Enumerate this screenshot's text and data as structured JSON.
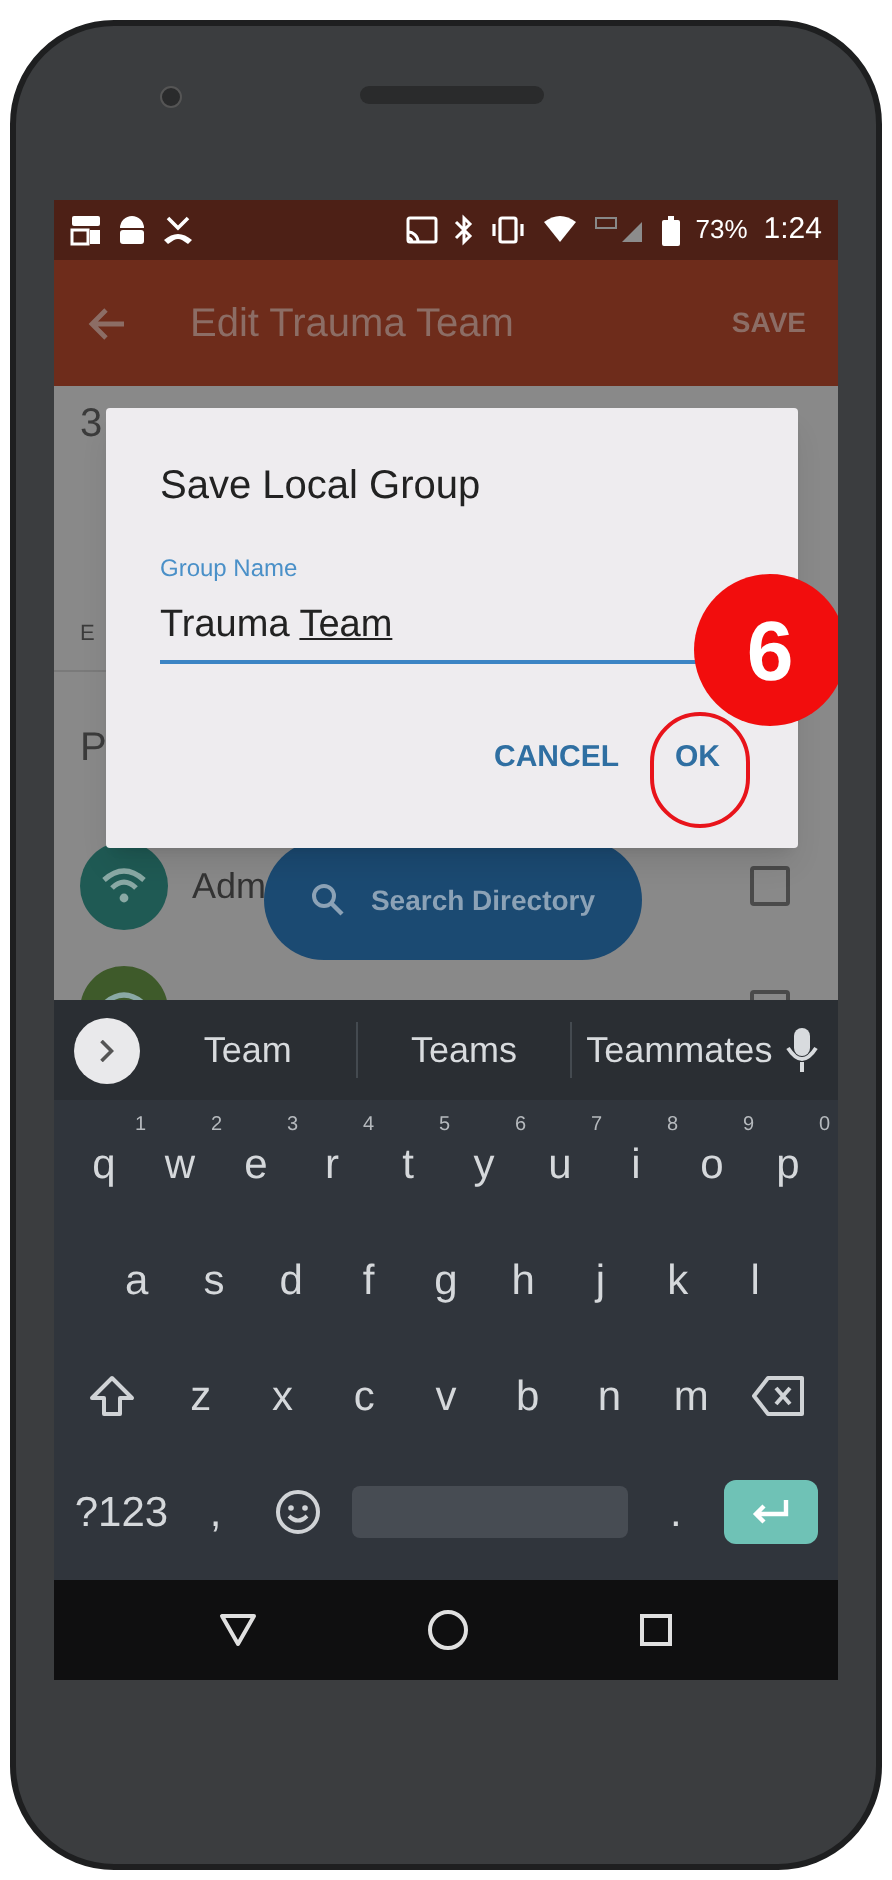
{
  "status_bar": {
    "battery": "73%",
    "time": "1:24"
  },
  "app_bar": {
    "title": "Edit Trauma Team",
    "action": "SAVE"
  },
  "background": {
    "count_fragment": "3",
    "label_fragment": "E",
    "section_fragment": "P",
    "members": [
      {
        "name": "Adm",
        "checked": false
      },
      {
        "checked": false
      }
    ]
  },
  "search_button": {
    "label": "Search Directory"
  },
  "dialog": {
    "title": "Save Local Group",
    "field": {
      "label": "Group Name",
      "value": "Trauma ",
      "composing": "Team"
    },
    "buttons": [
      "CANCEL",
      "OK"
    ]
  },
  "annotation": {
    "step": "6"
  },
  "keyboard": {
    "suggestions": [
      "Team",
      "Teams",
      "Teammates"
    ],
    "rows": [
      [
        {
          "label": "q",
          "hint": "1"
        },
        {
          "label": "w",
          "hint": "2"
        },
        {
          "label": "e",
          "hint": "3"
        },
        {
          "label": "r",
          "hint": "4"
        },
        {
          "label": "t",
          "hint": "5"
        },
        {
          "label": "y",
          "hint": "6"
        },
        {
          "label": "u",
          "hint": "7"
        },
        {
          "label": "i",
          "hint": "8"
        },
        {
          "label": "o",
          "hint": "9"
        },
        {
          "label": "p",
          "hint": "0"
        }
      ],
      [
        {
          "label": "a"
        },
        {
          "label": "s"
        },
        {
          "label": "d"
        },
        {
          "label": "f"
        },
        {
          "label": "g"
        },
        {
          "label": "h"
        },
        {
          "label": "j"
        },
        {
          "label": "k"
        },
        {
          "label": "l"
        }
      ],
      [
        {
          "kind": "shift"
        },
        {
          "label": "z"
        },
        {
          "label": "x"
        },
        {
          "label": "c"
        },
        {
          "label": "v"
        },
        {
          "label": "b"
        },
        {
          "label": "n"
        },
        {
          "label": "m"
        },
        {
          "kind": "backspace"
        }
      ]
    ],
    "bottom_row": [
      {
        "label": "?123"
      },
      {
        "label": ","
      },
      {
        "kind": "emoji"
      },
      {
        "kind": "space"
      },
      {
        "label": "."
      },
      {
        "kind": "enter"
      }
    ]
  }
}
